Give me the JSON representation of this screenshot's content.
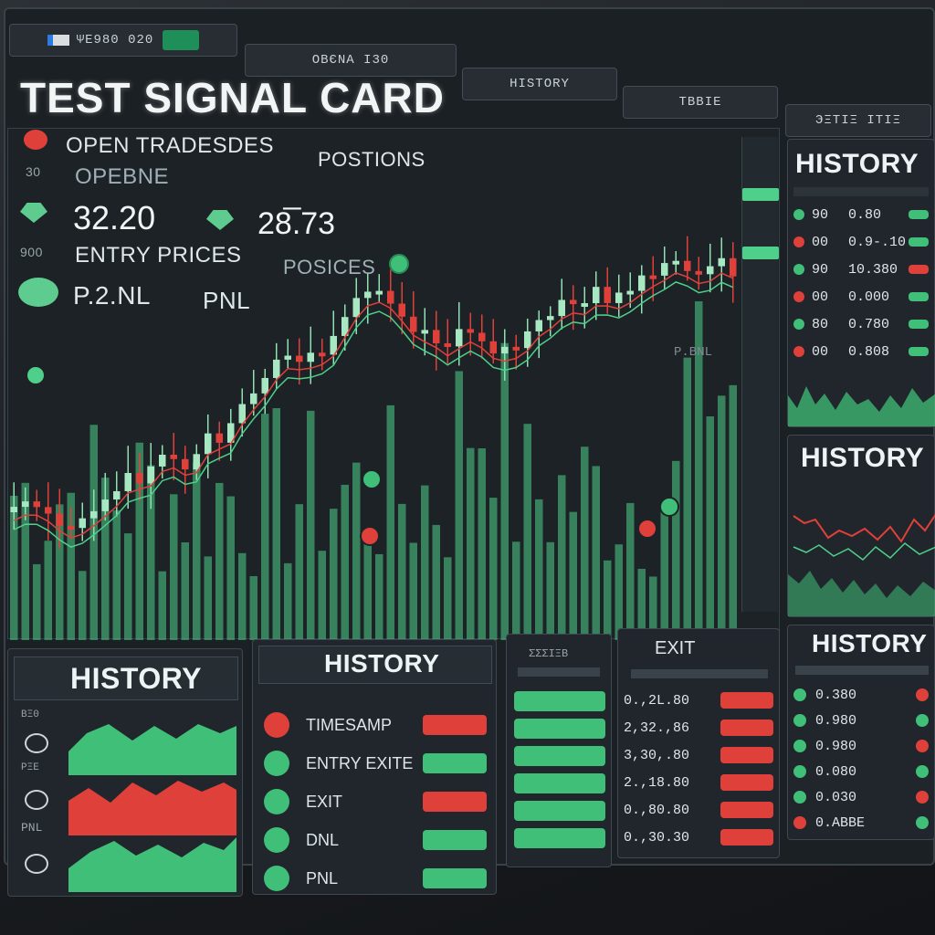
{
  "tabs": [
    {
      "label": "ΨΕ980 020"
    },
    {
      "label": "OBЄNA Ι30"
    },
    {
      "label": "HISTORY"
    },
    {
      "label": "TBBIE"
    },
    {
      "label": "ЭΞΤΙΞ ΙΤΙΞ"
    }
  ],
  "card": {
    "title": "TEST SIGNAL CARD",
    "open_trades": "OPEN TRADESDES",
    "positions": "POSTIONS",
    "opene": "OPEBNE",
    "value1": "32.20",
    "value2": "28̅.73",
    "entry_prices": "ENTRY PRICES",
    "posices": "POSICES",
    "pnl1": "P.2.NL",
    "pnl2": "PNL",
    "side_900": "900",
    "side_30": "30"
  },
  "chart_data": {
    "type": "candlestick",
    "annotation": "P.BNL",
    "y_side_labels": [
      "",
      "",
      "",
      "",
      "",
      "",
      "",
      "",
      ""
    ]
  },
  "history_top": {
    "title": "HISTORY",
    "rows": [
      {
        "a": "90",
        "b": "0.80"
      },
      {
        "a": "00",
        "b": "0.9-.10"
      },
      {
        "a": "90",
        "b": "10.380"
      },
      {
        "a": "00",
        "b": "0.000"
      },
      {
        "a": "80",
        "b": "0.780"
      },
      {
        "a": "00",
        "b": "0.808"
      }
    ]
  },
  "history_mid": {
    "title": "HISTORY"
  },
  "history_b1": {
    "title": "HISTORY",
    "side": [
      "ΒΞ0",
      "",
      "ΡΞΕ",
      "",
      "PNL",
      ""
    ]
  },
  "history_b2": {
    "title": "HISTORY",
    "rows": [
      "TIMESAMP",
      "ENTRY EXITE",
      "EXIT",
      "DNL",
      "PNL"
    ]
  },
  "panel_b3": {
    "header": "ΣΣΣΙΞΒ"
  },
  "panel_b4": {
    "title": "EXIT",
    "rows": [
      "0.,2L.80",
      "2,32.,86",
      "3,30,.80",
      "2.,18.80",
      "0.,80.80",
      "0.,30.30"
    ]
  },
  "history_b5": {
    "title": "HISTORY",
    "rows": [
      "0.380",
      "0.980",
      "0.980",
      "0.080",
      "0.030",
      "0.ABBE"
    ]
  }
}
